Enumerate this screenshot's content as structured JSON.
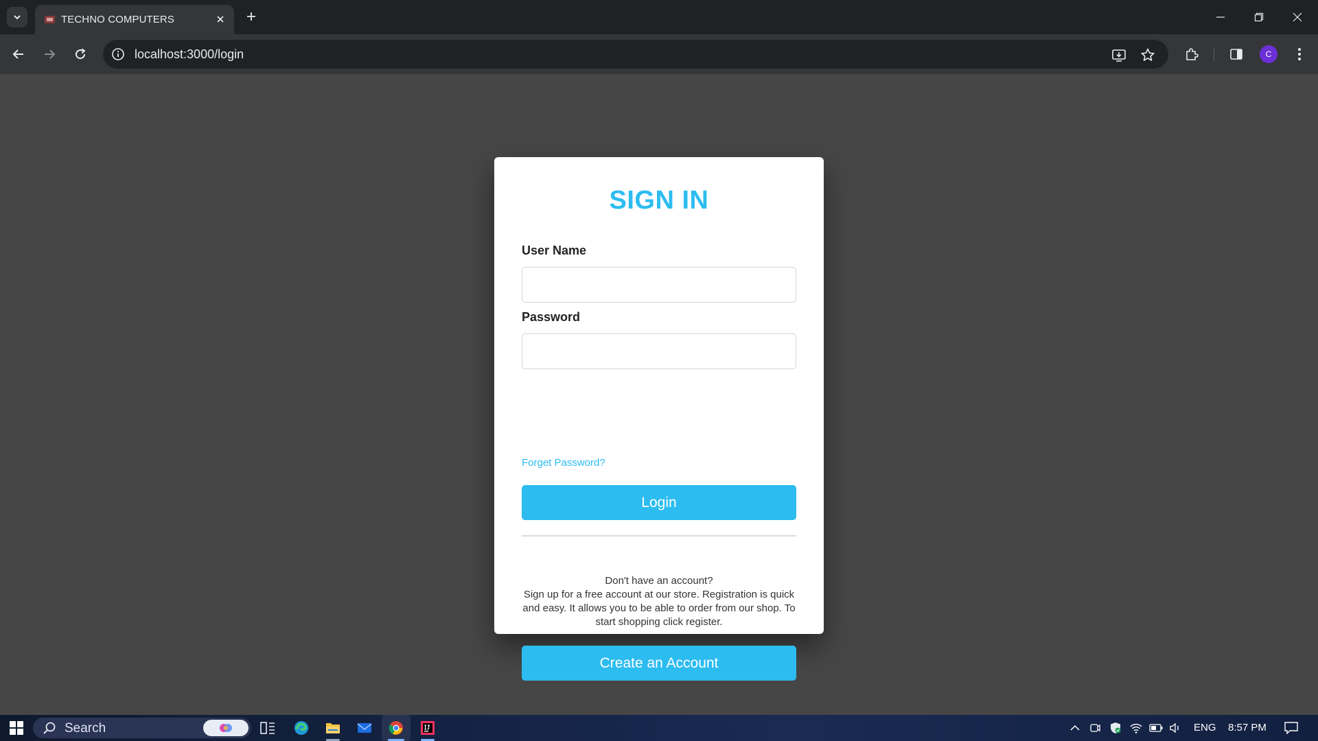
{
  "browser": {
    "tab_title": "TECHNO COMPUTERS",
    "url": "localhost:3000/login",
    "profile_initial": "C"
  },
  "login_card": {
    "title": "SIGN IN",
    "username_label": "User Name",
    "username_value": "",
    "password_label": "Password",
    "password_value": "",
    "forgot_password": "Forget Password?",
    "login_button": "Login",
    "signup_heading": "Don't have an account?",
    "signup_text": "Sign up for a free account at our store. Registration is quick and easy. It allows you to be able to order from our shop. To start shopping click register.",
    "create_account_button": "Create an Account"
  },
  "taskbar": {
    "search_label": "Search",
    "language": "ENG",
    "time": "8:57 PM"
  },
  "colors": {
    "accent": "#2cbcf0",
    "page_background": "#464646",
    "card_background": "#ffffff"
  }
}
